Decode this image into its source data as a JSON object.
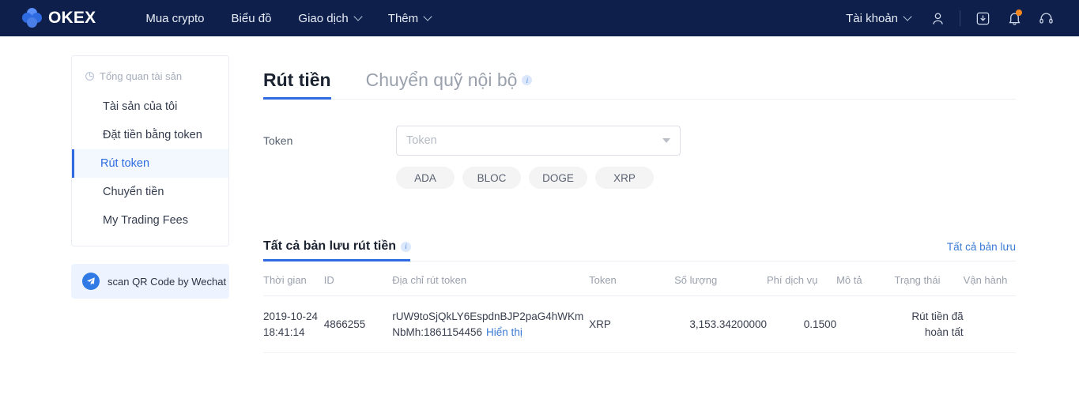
{
  "header": {
    "brand": "OKEX",
    "nav": [
      {
        "label": "Mua crypto",
        "caret": false,
        "name": "nav-buy-crypto"
      },
      {
        "label": "Biểu đồ",
        "caret": false,
        "name": "nav-charts"
      },
      {
        "label": "Giao dịch",
        "caret": true,
        "name": "nav-trade"
      },
      {
        "label": "Thêm",
        "caret": true,
        "name": "nav-more"
      }
    ],
    "account_label": "Tài khoản",
    "icons": [
      "user-icon",
      "download-icon",
      "bell-icon",
      "headset-icon"
    ],
    "bg_color": "#0d1f4a",
    "badge_color": "#f5871f"
  },
  "sidebar": {
    "section_title": "Tổng quan tài sản",
    "items": [
      {
        "label": "Tài sản của tôi",
        "active": false
      },
      {
        "label": "Đặt tiền bằng token",
        "active": false
      },
      {
        "label": "Rút token",
        "active": true
      },
      {
        "label": "Chuyển tiền",
        "active": false
      },
      {
        "label": "My Trading Fees",
        "active": false
      }
    ],
    "promo": {
      "label": "scan QR Code by Wechat"
    },
    "accent_color": "#2f6be0"
  },
  "main": {
    "tabs": [
      {
        "label": "Rút tiền",
        "active": true,
        "info": false
      },
      {
        "label": "Chuyển quỹ nội bộ",
        "active": false,
        "info": true
      }
    ],
    "form": {
      "token_label": "Token",
      "token_placeholder": "Token",
      "token_value": "",
      "chips": [
        "ADA",
        "BLOC",
        "DOGE",
        "XRP"
      ]
    },
    "records": {
      "title": "Tất cả bản lưu rút tiền",
      "all_link": "Tất cả bản lưu",
      "columns": [
        "Thời gian",
        "ID",
        "Địa chỉ rút token",
        "Token",
        "Số lượng",
        "Phí dịch vụ",
        "Mô tả",
        "Trạng thái",
        "Vận hành"
      ],
      "rows": [
        {
          "date": "2019-10-24",
          "time": "18:41:14",
          "id": "4866255",
          "address": "rUW9toSjQkLY6EspdnBJP2paG4hWKm",
          "memo": "NbMh:1861154456",
          "show_link": "Hiển thị",
          "token": "XRP",
          "amount": "3,153.34200000",
          "fee": "0.1500",
          "description": "",
          "status": "Rút tiền đã hoàn tất",
          "operation": ""
        }
      ]
    }
  }
}
